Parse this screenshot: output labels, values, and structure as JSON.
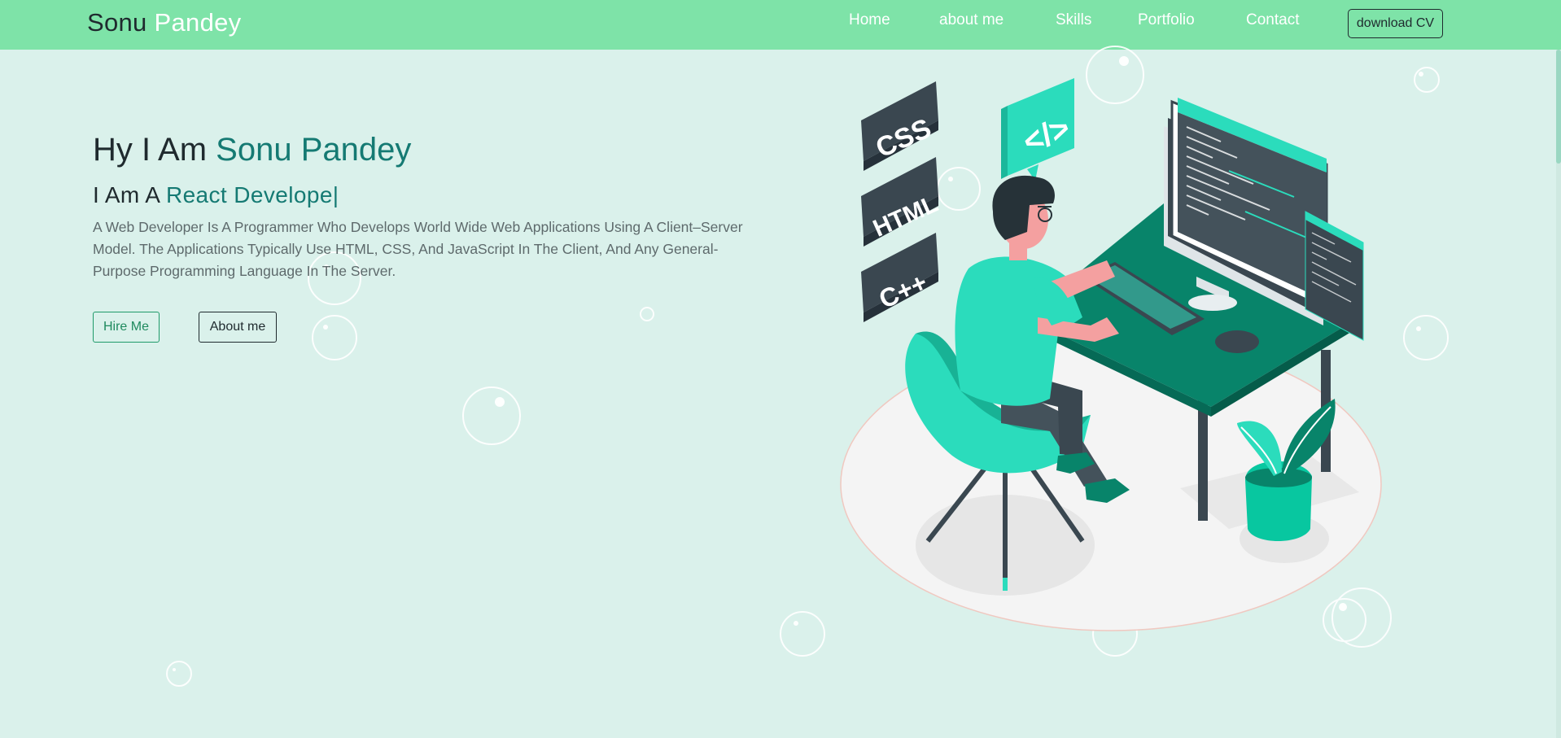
{
  "brand": {
    "first": "Sonu",
    "last": "Pandey"
  },
  "nav": {
    "items": [
      {
        "label": "Home"
      },
      {
        "label": "about me"
      },
      {
        "label": "Skills"
      },
      {
        "label": "Portfolio"
      },
      {
        "label": "Contact"
      }
    ],
    "cv_button": "download CV"
  },
  "hero": {
    "greeting": "Hy I Am",
    "name": "Sonu Pandey",
    "role_prefix": "I Am A",
    "role": "React Develope|",
    "description": "A Web Developer Is A Programmer Who Develops World Wide Web Applications Using A Client–Server Model. The Applications Typically Use HTML, CSS, And JavaScript In The Client, And Any General-Purpose Programming Language In The Server.",
    "hire_button": "Hire Me",
    "about_button": "About me"
  },
  "illustration": {
    "badges": [
      "CSS",
      "HTML",
      "C++"
    ],
    "code_icon": "</>"
  },
  "colors": {
    "navbar": "#7ee3a8",
    "background": "#daf1eb",
    "accent": "#157a73",
    "illustration_green": "#2bdcbc",
    "desk_green": "#08846a"
  }
}
